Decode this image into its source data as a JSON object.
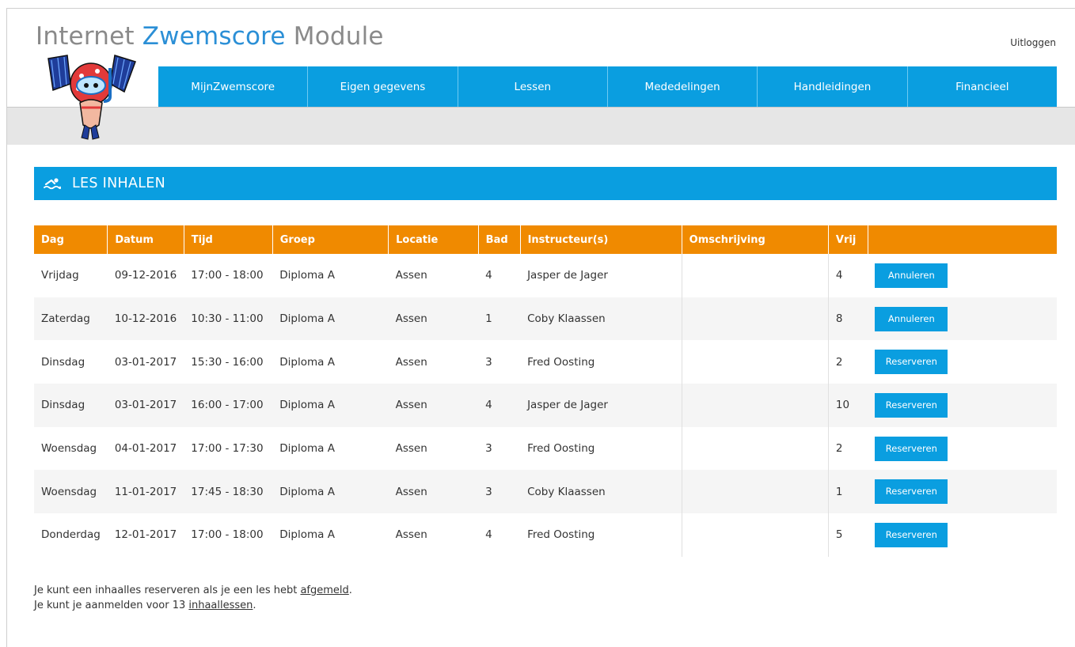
{
  "header": {
    "title_part1": "Internet ",
    "title_accent": "Zwemscore",
    "title_part2": " Module",
    "logout_label": "Uitloggen"
  },
  "nav": {
    "items": [
      {
        "label": "MijnZwemscore"
      },
      {
        "label": "Eigen gegevens"
      },
      {
        "label": "Lessen"
      },
      {
        "label": "Mededelingen"
      },
      {
        "label": "Handleidingen"
      },
      {
        "label": "Financieel"
      }
    ]
  },
  "section": {
    "title": "LES INHALEN",
    "icon": "swimmer-icon"
  },
  "table": {
    "headers": [
      "Dag",
      "Datum",
      "Tijd",
      "Groep",
      "Locatie",
      "Bad",
      "Instructeur(s)",
      "Omschrijving",
      "Vrij",
      ""
    ],
    "rows": [
      {
        "dag": "Vrijdag",
        "datum": "09-12-2016",
        "tijd": "17:00 - 18:00",
        "groep": "Diploma A",
        "locatie": "Assen",
        "bad": "4",
        "instructeur": "Jasper de Jager",
        "omschrijving": "",
        "vrij": "4",
        "action": "Annuleren"
      },
      {
        "dag": "Zaterdag",
        "datum": "10-12-2016",
        "tijd": "10:30 - 11:00",
        "groep": "Diploma A",
        "locatie": "Assen",
        "bad": "1",
        "instructeur": "Coby Klaassen",
        "omschrijving": "",
        "vrij": "8",
        "action": "Annuleren"
      },
      {
        "dag": "Dinsdag",
        "datum": "03-01-2017",
        "tijd": "15:30 - 16:00",
        "groep": "Diploma A",
        "locatie": "Assen",
        "bad": "3",
        "instructeur": "Fred Oosting",
        "omschrijving": "",
        "vrij": "2",
        "action": "Reserveren"
      },
      {
        "dag": "Dinsdag",
        "datum": "03-01-2017",
        "tijd": "16:00 - 17:00",
        "groep": "Diploma A",
        "locatie": "Assen",
        "bad": "4",
        "instructeur": "Jasper de Jager",
        "omschrijving": "",
        "vrij": "10",
        "action": "Reserveren"
      },
      {
        "dag": "Woensdag",
        "datum": "04-01-2017",
        "tijd": "17:00 - 17:30",
        "groep": "Diploma A",
        "locatie": "Assen",
        "bad": "3",
        "instructeur": "Fred Oosting",
        "omschrijving": "",
        "vrij": "2",
        "action": "Reserveren"
      },
      {
        "dag": "Woensdag",
        "datum": "11-01-2017",
        "tijd": "17:45 - 18:30",
        "groep": "Diploma A",
        "locatie": "Assen",
        "bad": "3",
        "instructeur": "Coby Klaassen",
        "omschrijving": "",
        "vrij": "1",
        "action": "Reserveren"
      },
      {
        "dag": "Donderdag",
        "datum": "12-01-2017",
        "tijd": "17:00 - 18:00",
        "groep": "Diploma A",
        "locatie": "Assen",
        "bad": "4",
        "instructeur": "Fred Oosting",
        "omschrijving": "",
        "vrij": "5",
        "action": "Reserveren"
      }
    ]
  },
  "notes": {
    "line1_text": "Je kunt een inhaalles reserveren als je een les hebt ",
    "line1_link": "afgemeld",
    "line1_end": ".",
    "line2_text": "Je kunt je aanmelden voor 13 ",
    "line2_link": "inhaallessen",
    "line2_end": "."
  },
  "colors": {
    "brand_blue": "#0a9ee0",
    "table_header_orange": "#f08a00",
    "title_grey": "#8a8a8a",
    "title_accent_blue": "#2b8fd6"
  }
}
